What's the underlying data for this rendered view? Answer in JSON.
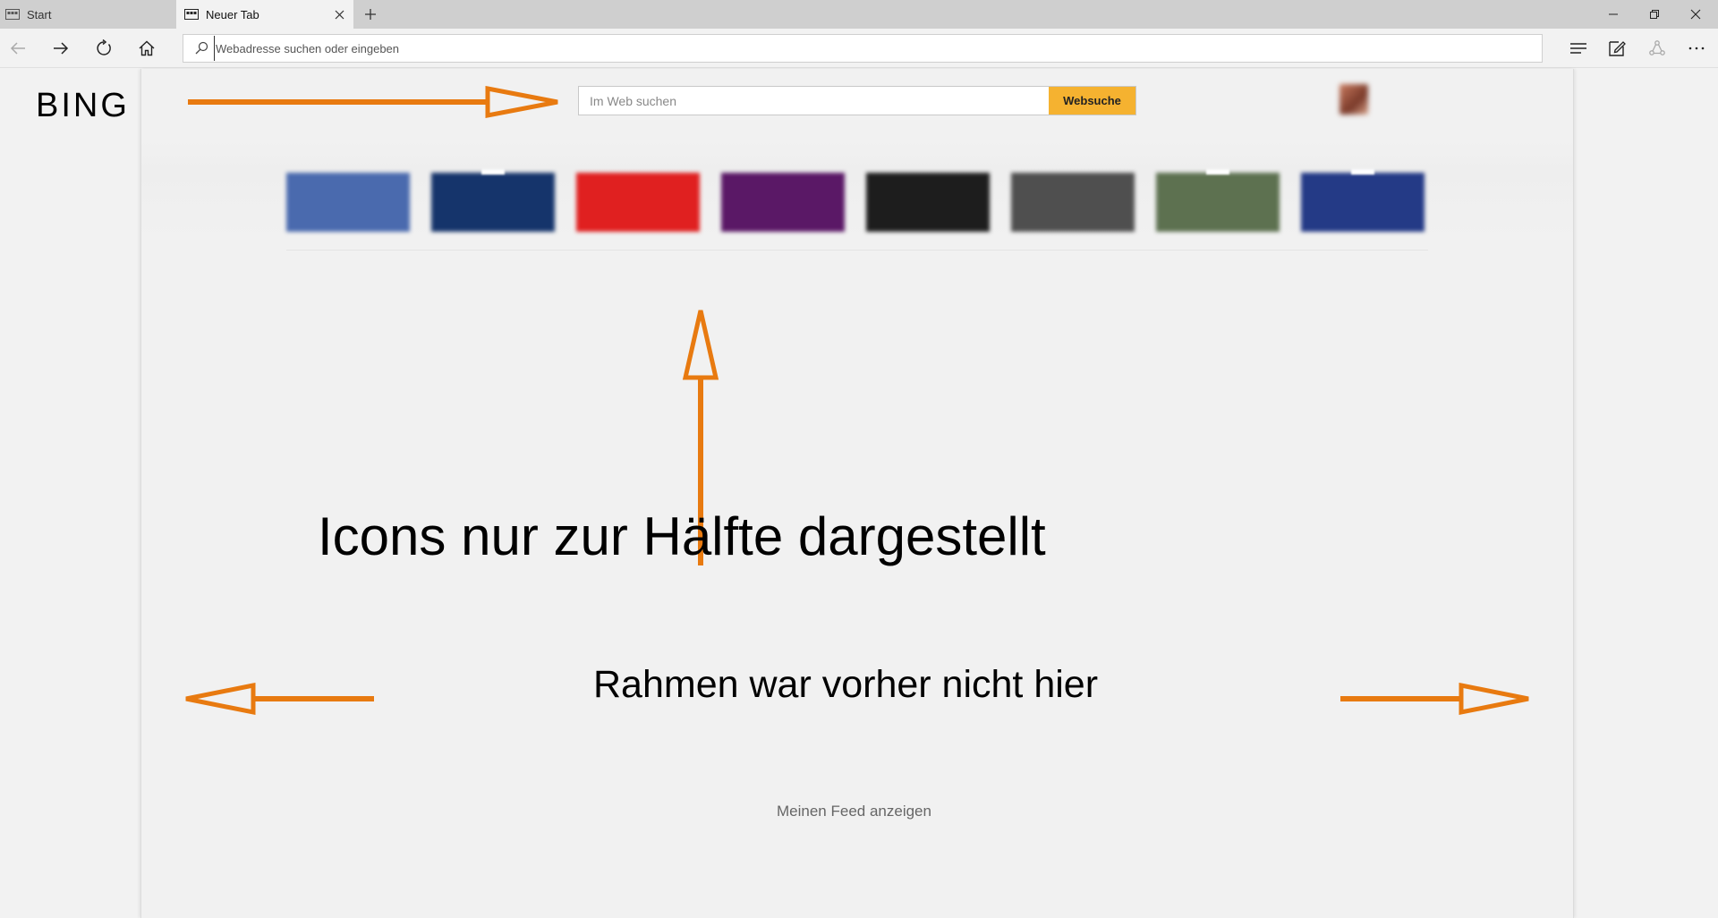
{
  "browser": {
    "tabs": [
      {
        "label": "Start",
        "active": false
      },
      {
        "label": "Neuer Tab",
        "active": true
      }
    ],
    "address_placeholder": "Webadresse suchen oder eingeben"
  },
  "page": {
    "logo": "BING",
    "search": {
      "placeholder": "Im Web suchen",
      "button_label": "Websuche"
    },
    "tiles": [
      {
        "color": "#4a6aae"
      },
      {
        "color": "#15346b"
      },
      {
        "color": "#e02020"
      },
      {
        "color": "#5a1866"
      },
      {
        "color": "#1d1d1d"
      },
      {
        "color": "#4f4f4f"
      },
      {
        "color": "#5d7150"
      },
      {
        "color": "#243a86"
      }
    ],
    "feed_link": "Meinen Feed anzeigen"
  },
  "annotations": {
    "icons_text": "Icons nur zur Hälfte dargestellt",
    "frame_text": "Rahmen war vorher nicht hier",
    "arrow_color": "#e87a10"
  }
}
